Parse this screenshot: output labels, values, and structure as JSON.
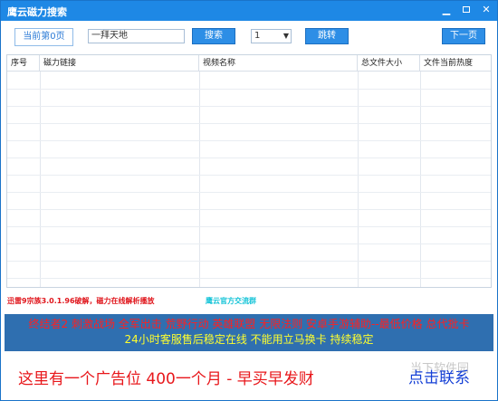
{
  "window": {
    "title": "鹰云磁力搜索",
    "min_glyph": "▁",
    "close_glyph": "✕"
  },
  "toolbar": {
    "page_label": "当前第0页",
    "search_value": "一拜天地",
    "search_button": "搜索",
    "page_select_value": "1",
    "jump_button": "跳转",
    "next_button": "下一页"
  },
  "table": {
    "columns": [
      "序号",
      "磁力链接",
      "视频名称",
      "总文件大小",
      "文件当前热度"
    ],
    "rows": []
  },
  "footer": {
    "version_link": "迅雷9宗族3.0.1.96破解，磁力在线解析播放",
    "group_link": "鹰云官方交流群"
  },
  "ad_banner": {
    "line1": "终结者2  刺激战场 全军出击 荒野行动 英雄联盟  无限法则  安卓手游辅助--最低价格 总代批卡",
    "line2": "24小时客服售后稳定在线    不能用立马换卡 持续稳定"
  },
  "bottom_ad": {
    "text": "这里有一个广告位 400一个月  - 早买早发财",
    "contact": "点击联系",
    "watermark": "当下软件园"
  },
  "colors": {
    "titlebar": "#1e88e5",
    "button": "#2d8ee6",
    "ad_banner_bg": "#2f6fb0",
    "ad_red": "#ff2020",
    "ad_yellow": "#ffff2e",
    "contact_blue": "#1540d6"
  },
  "icons": {
    "minimize": "minimize-icon",
    "maximize": "maximize-icon",
    "close": "close-icon",
    "dropdown": "chevron-down-icon"
  }
}
